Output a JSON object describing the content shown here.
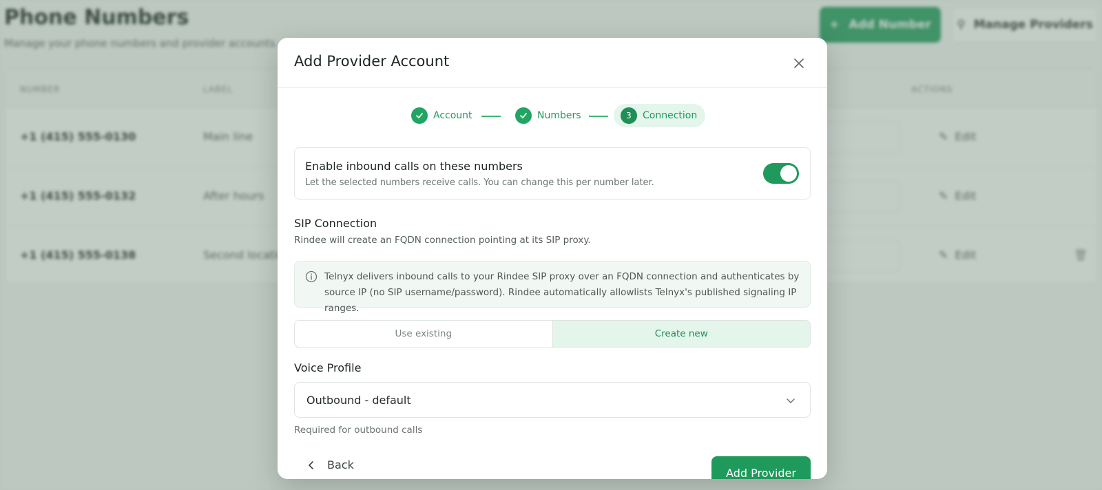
{
  "background": {
    "title": "Phone Numbers",
    "subtitle": "Manage your phone numbers and provider accounts.",
    "add_button": "Add Number",
    "manage_button": "Manage Providers",
    "columns": [
      "NUMBER",
      "LABEL",
      "ACTIONS"
    ],
    "rows": [
      {
        "number": "+1 (415) 555-0130",
        "label": "Main line",
        "action": "Edit"
      },
      {
        "number": "+1 (415) 555-0132",
        "label": "After hours",
        "action": "Edit"
      },
      {
        "number": "+1 (415) 555-0138",
        "label": "Second location",
        "action": "Edit"
      }
    ]
  },
  "modal": {
    "title": "Add Provider Account",
    "steps": [
      {
        "label": "Account",
        "state": "done"
      },
      {
        "label": "Numbers",
        "state": "done"
      },
      {
        "label": "Connection",
        "state": "active",
        "index": "3"
      }
    ],
    "inbound": {
      "title": "Enable inbound calls on these numbers",
      "description": "Let the selected numbers receive calls. You can change this per number later.",
      "enabled": true
    },
    "sip": {
      "title": "SIP Connection",
      "description": "Rindee will create an FQDN connection pointing at its SIP proxy.",
      "info": "Telnyx delivers inbound calls to your Rindee SIP proxy over an FQDN connection and authenticates by source IP (no SIP username/password). Rindee automatically allowlists Telnyx's published signaling IP ranges.",
      "options": [
        "Use existing",
        "Create new"
      ],
      "selected_option": "Create new"
    },
    "voice_profile": {
      "label": "Voice Profile",
      "value": "Outbound - default",
      "help": "Required for outbound calls"
    },
    "back_label": "Back",
    "submit_label": "Add Provider"
  },
  "colors": {
    "accent": "#1f9a5c",
    "accent_light": "#e4f5ec"
  }
}
